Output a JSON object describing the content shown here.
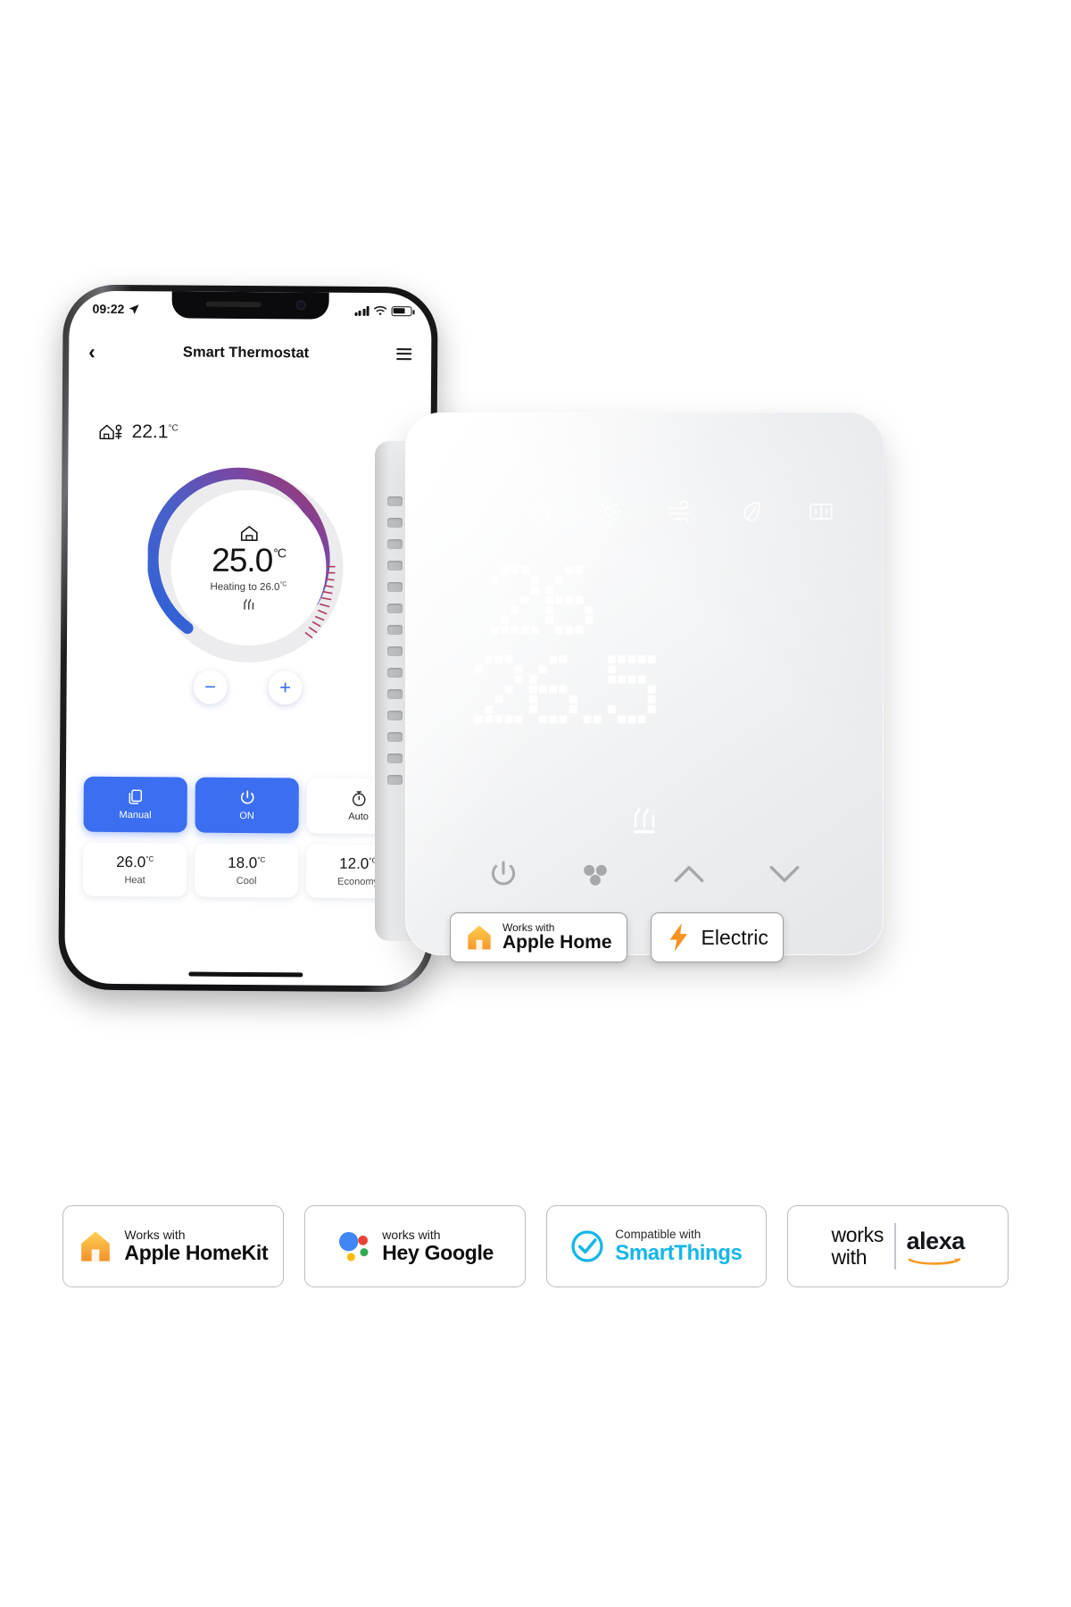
{
  "phone": {
    "status": {
      "time": "09:22",
      "location_icon": "location-arrow-icon",
      "signal_icon": "cellular-bars-icon",
      "wifi_icon": "wifi-icon",
      "battery_icon": "battery-icon"
    },
    "appbar": {
      "back_icon": "chevron-left-icon",
      "title": "Smart Thermostat",
      "menu_icon": "hamburger-menu-icon"
    },
    "ambient": {
      "icon": "home-sensor-icon",
      "value": "22.1",
      "unit": "°C"
    },
    "dial": {
      "home_icon": "home-icon",
      "current": "25.0",
      "unit": "°C",
      "status": "Heating to 26.0",
      "status_unit": "°C",
      "heat_icon": "heat-waves-icon",
      "arc_start_color": "#2f62d8",
      "arc_end_color": "#a8325f"
    },
    "stepper": {
      "minus": "−",
      "plus": "+",
      "color": "#2f6bf0"
    },
    "modes": [
      {
        "icon": "copy-pages-icon",
        "label": "Manual",
        "active": true
      },
      {
        "icon": "power-icon",
        "label": "ON",
        "active": true
      },
      {
        "icon": "timer-icon",
        "label": "Auto",
        "active": false
      }
    ],
    "presets": [
      {
        "value": "26.0",
        "unit": "°C",
        "label": "Heat"
      },
      {
        "value": "18.0",
        "unit": "°C",
        "label": "Cool"
      },
      {
        "value": "12.0",
        "unit": "°C",
        "label": "Economy"
      }
    ],
    "accent": "#3b6ef0"
  },
  "device": {
    "top_icons": [
      "wifi-icon",
      "timer-icon",
      "sun-icon",
      "wind-icon",
      "leaf-icon",
      "window-icon"
    ],
    "display": {
      "line1": "26",
      "line2": "26.5",
      "style": "dot-matrix-led"
    },
    "flame_icon": "heat-waves-icon",
    "buttons": [
      "power-icon",
      "fan-icon",
      "chevron-up-icon",
      "chevron-down-icon"
    ],
    "badges": [
      {
        "icon": "apple-home-house-icon",
        "small": "Works with",
        "large": "Apple Home"
      },
      {
        "icon": "lightning-bolt-icon",
        "large": "Electric"
      }
    ]
  },
  "logo_bar": [
    {
      "name": "apple-homekit-logo",
      "icon": "apple-home-house-icon",
      "small": "Works with",
      "large": "Apple HomeKit"
    },
    {
      "name": "hey-google-logo",
      "icon": "google-dots-icon",
      "small": "works with",
      "large": "Hey Google"
    },
    {
      "name": "smartthings-logo",
      "icon": "smartthings-check-icon",
      "small": "Compatible with",
      "large": "SmartThings",
      "accent": "#15b6e8"
    },
    {
      "name": "alexa-logo",
      "small": "works",
      "small2": "with",
      "large": "alexa"
    }
  ]
}
